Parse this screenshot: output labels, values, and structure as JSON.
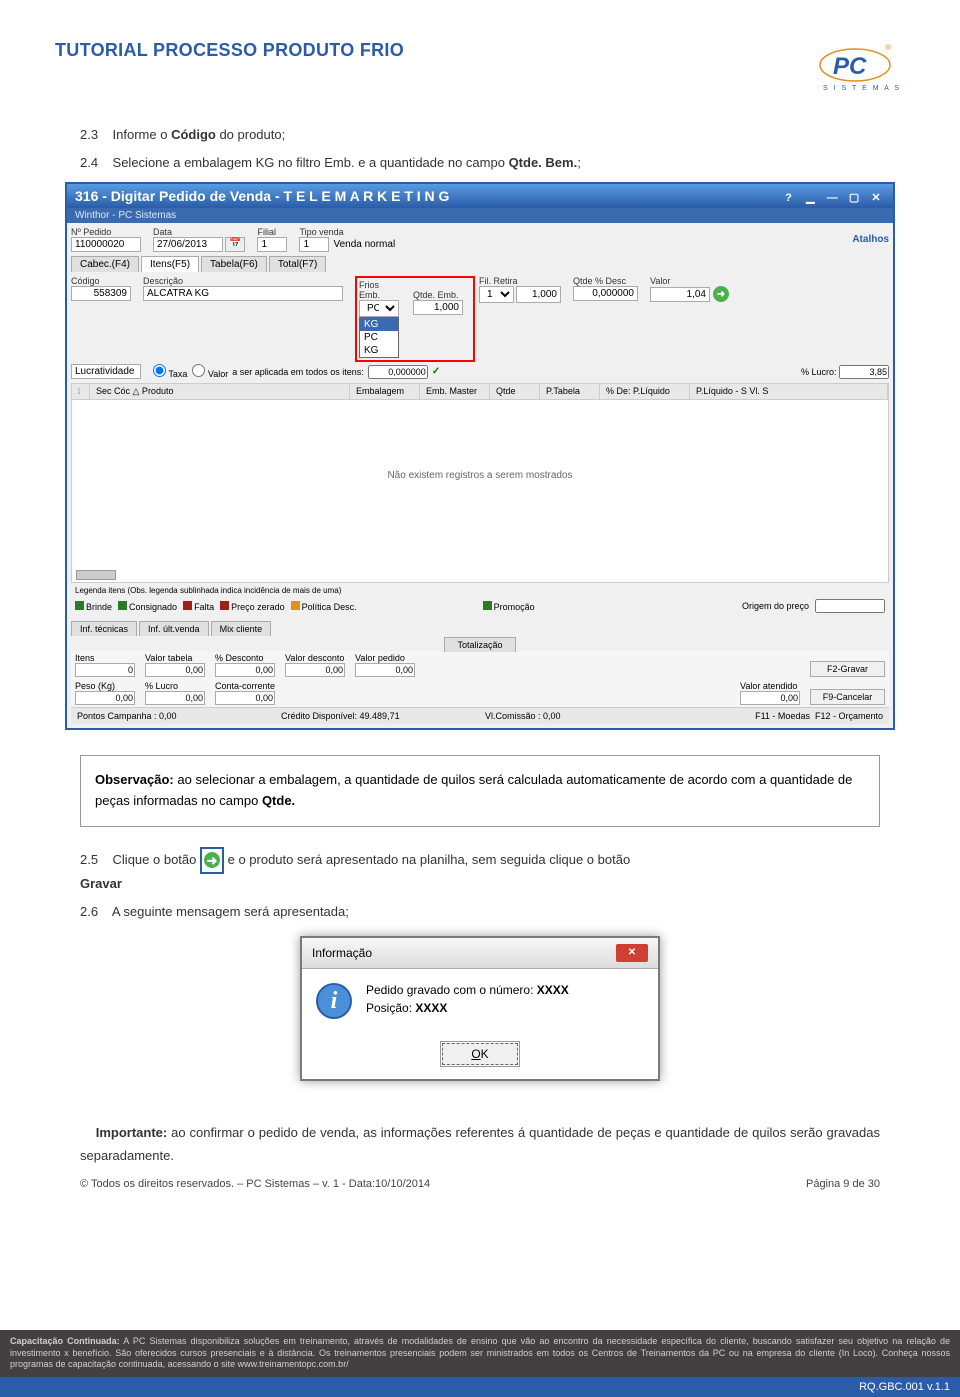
{
  "header": {
    "title": "TUTORIAL PROCESSO PRODUTO FRIO",
    "logo_text_top": "PC",
    "logo_text_bottom": "S I S T E M A S"
  },
  "steps": {
    "s23_num": "2.3",
    "s23_text": "Informe o ",
    "s23_bold": "Código",
    "s23_after": " do produto;",
    "s24_num": "2.4",
    "s24_text": "Selecione a embalagem KG no filtro Emb. e a quantidade no campo ",
    "s24_bold": "Qtde. Bem.",
    "s24_after": ";",
    "s25_num": "2.5",
    "s25_text_a": "Clique o botão ",
    "s25_text_b": " e o produto será apresentado na planilha, sem seguida clique o botão",
    "s25_gravar": "Gravar",
    "s26_num": "2.6",
    "s26_text": "A seguinte mensagem será apresentada;"
  },
  "win": {
    "title": "316 - Digitar Pedido de Venda - T E L E M A R K E T I N G",
    "subtitle": "Winthor - PC Sistemas",
    "atalhos": "Atalhos",
    "labels": {
      "pedido": "Nº Pedido",
      "data": "Data",
      "filial": "Filial",
      "tipo_venda": "Tipo venda",
      "venda_normal": "Venda normal",
      "codigo": "Código",
      "descricao": "Descrição",
      "frios": "Frios",
      "emb": "Emb.",
      "qtde_emb": "Qtde. Emb.",
      "fil_retira": "Fil. Retira",
      "qtde_desc": "Qtde % Desc",
      "valor": "Valor",
      "lucratividade": "Lucratividade",
      "taxa": "Taxa",
      "valor2": "Valor",
      "ser_aplicada": "a ser aplicada em todos os itens:",
      "pct_lucro": "% Lucro:"
    },
    "values": {
      "pedido": "110000020",
      "data": "27/06/2013",
      "filial": "1",
      "tipo_venda": "1",
      "codigo": "558309",
      "descricao": "ALCATRA KG",
      "emb": "PC",
      "qtde_emb": "1,000",
      "fil_retira": "1",
      "fil_retira_qtd": "1,000",
      "qtde_desc": "0,000000",
      "valor": "1,04",
      "aplicada": "0,000000",
      "pct_lucro": "3,85"
    },
    "dropdown": [
      "KG",
      "PC",
      "KG"
    ],
    "tabs": [
      "Cabec.(F4)",
      "Itens(F5)",
      "Tabela(F6)",
      "Total(F7)"
    ],
    "grid_headers": [
      "Sec Cóc △ Produto",
      "Embalagem",
      "Emb. Master",
      "Qtde",
      "P.Tabela",
      "% De: P.Líquido",
      "P.Líquido - S Vl. S"
    ],
    "grid_empty": "Não existem registros a serem mostrados",
    "legend_title": "Legenda itens (Obs. legenda sublinhada indica incidência de mais de uma)",
    "legend_items": [
      "Brinde",
      "Consignado",
      "Falta",
      "Preço zerado",
      "Política Desc.",
      "Promoção"
    ],
    "legend_colors": [
      "#2a7a2a",
      "#2a7a2a",
      "#a02020",
      "#a02020",
      "#e09020",
      "#2a7a2a"
    ],
    "origem_preco": "Origem do preço",
    "second_tabs": [
      "Inf. técnicas",
      "Inf. últ.venda",
      "Mix cliente"
    ],
    "totalizacao": "Totalização",
    "totals": {
      "itens": "Itens",
      "itens_v": "0",
      "valor_tabela": "Valor tabela",
      "valor_tabela_v": "0,00",
      "pct_desconto": "% Desconto",
      "pct_desconto_v": "0,00",
      "valor_desconto": "Valor desconto",
      "valor_desconto_v": "0,00",
      "valor_pedido": "Valor pedido",
      "valor_pedido_v": "0,00",
      "peso": "Peso (Kg)",
      "peso_v": "0,00",
      "pct_lucro": "% Lucro",
      "pct_lucro_v": "0,00",
      "conta_corrente": "Conta-corrente",
      "conta_corrente_v": "0,00",
      "valor_atendido": "Valor atendido",
      "valor_atendido_v": "0,00"
    },
    "side_btns": [
      "F2-Gravar",
      "F9-Cancelar"
    ],
    "status": {
      "pontos": "Pontos Campanha : 0,00",
      "credito": "Crédito Disponível: 49.489,71",
      "comissao": "Vl.Comissão : 0,00",
      "f11": "F11 - Moedas",
      "f12": "F12 - Orçamento"
    }
  },
  "obs": {
    "label": "Observação:",
    "text": " ao selecionar a embalagem, a quantidade de quilos será calculada automaticamente de acordo com a quantidade de peças informadas no campo ",
    "bold": "Qtde."
  },
  "dialog": {
    "title": "Informação",
    "line1a": "Pedido gravado com o número: ",
    "line1b": "XXXX",
    "line2a": "Posição: ",
    "line2b": "XXXX",
    "ok": "OK"
  },
  "important": {
    "label": "Importante:",
    "text": " ao confirmar o pedido de venda, as informações referentes á quantidade de peças e quantidade de quilos serão gravadas separadamente."
  },
  "copyright": {
    "left": "© Todos os direitos reservados. – PC Sistemas – v. 1 - Data:10/10/2014",
    "right": "Página 9 de 30"
  },
  "footer": {
    "bold": "Capacitação Continuada:",
    "text": " A PC Sistemas disponibiliza soluções em treinamento, através de modalidades de ensino que vão ao encontro da necessidade específica do cliente, buscando satisfazer seu objetivo na relação de investimento x benefício. São oferecidos cursos presenciais e à distância. Os treinamentos presenciais podem ser ministrados em todos os Centros de Treinamentos da PC ou na empresa do cliente (In Loco). Conheça nossos programas de capacitação continuada, acessando o site www.treinamentopc.com.br/"
  },
  "rq": "RQ.GBC.001 v.1.1"
}
